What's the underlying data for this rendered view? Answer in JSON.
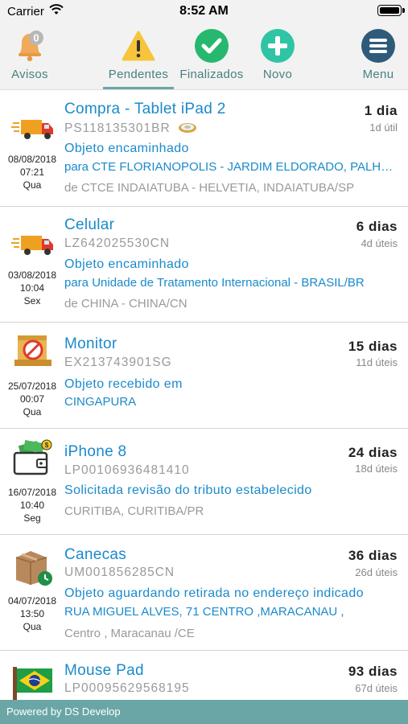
{
  "status_bar": {
    "carrier": "Carrier",
    "time": "8:52 AM"
  },
  "toolbar": {
    "avisos": {
      "label": "Avisos",
      "badge": "0"
    },
    "pendentes": {
      "label": "Pendentes"
    },
    "finalizados": {
      "label": "Finalizados"
    },
    "novo": {
      "label": "Novo"
    },
    "menu": {
      "label": "Menu"
    },
    "accent_color": "#6ba6a6",
    "label_color": "#4a8080"
  },
  "items": [
    {
      "icon": "delivery-truck-icon",
      "title": "Compra - Tablet iPad 2",
      "code": "PS118135301BR",
      "days": "1 dia",
      "business_days": "1d útil",
      "date": "08/08/2018",
      "time": "07:21",
      "weekday": "Qua",
      "status": "Objeto encaminhado",
      "destination": "para CTE FLORIANOPOLIS - JARDIM ELDORADO, PALHOCA/SC",
      "origin": "de CTCE INDAIATUBA - HELVETIA, INDAIATUBA/SP"
    },
    {
      "icon": "delivery-truck-icon",
      "title": "Celular",
      "code": "LZ642025530CN",
      "days": "6 dias",
      "business_days": "4d úteis",
      "date": "03/08/2018",
      "time": "10:04",
      "weekday": "Sex",
      "status": "Objeto encaminhado",
      "destination": "para Unidade de Tratamento Internacional - BRASIL/BR",
      "origin": "de CHINA - CHINA/CN"
    },
    {
      "icon": "blocked-package-icon",
      "title": "Monitor",
      "code": "EX213743901SG",
      "days": "15 dias",
      "business_days": "11d úteis",
      "date": "25/07/2018",
      "time": "00:07",
      "weekday": "Qua",
      "status": "Objeto recebido em",
      "destination": "CINGAPURA",
      "origin": ""
    },
    {
      "icon": "wallet-money-icon",
      "title": "iPhone 8",
      "code": "LP00106936481410",
      "days": "24 dias",
      "business_days": "18d úteis",
      "date": "16/07/2018",
      "time": "10:40",
      "weekday": "Seg",
      "status": "Solicitada revisão do tributo estabelecido",
      "destination": "",
      "origin": "CURITIBA, CURITIBA/PR"
    },
    {
      "icon": "package-clock-icon",
      "title": "Canecas",
      "code": "UM001856285CN",
      "days": "36 dias",
      "business_days": "26d úteis",
      "date": "04/07/2018",
      "time": "13:50",
      "weekday": "Qua",
      "status": "Objeto aguardando retirada no endereço indicado",
      "destination": "RUA MIGUEL ALVES, 71 CENTRO ,MARACANAU ,",
      "origin": "Centro , Maracanau /CE"
    },
    {
      "icon": "brazil-flag-icon",
      "title": "Mouse Pad",
      "code": "LP00095629568195",
      "days": "93 dias",
      "business_days": "67d úteis"
    }
  ],
  "footer": {
    "text": "Powered by DS Develop",
    "color": "#6ba6a6"
  },
  "colors": {
    "link_blue": "#1a8acb",
    "muted_gray": "#9a9a9a"
  }
}
